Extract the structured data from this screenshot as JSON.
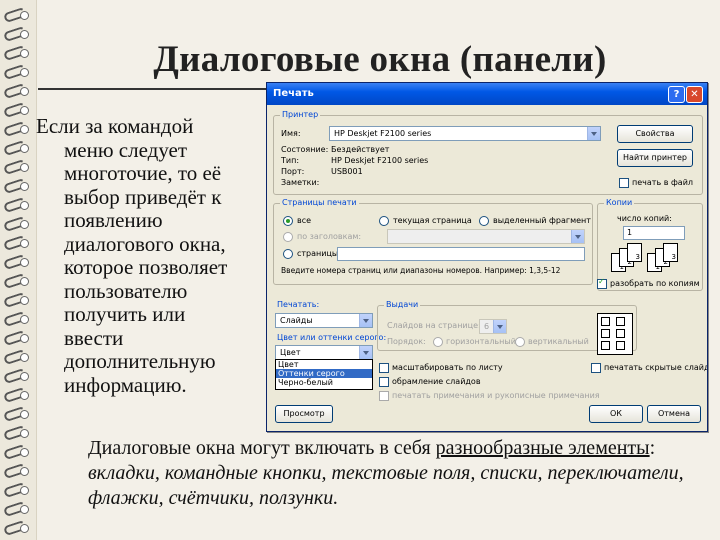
{
  "slide": {
    "title": "Диалоговые окна (панели)",
    "left_lines": [
      "Если за командой",
      "меню следует",
      "многоточие, то её",
      "выбор приведёт к",
      "появлению",
      "диалогового окна,",
      "которое позволяет",
      "пользователю",
      "получить или",
      "ввести",
      "дополнительную",
      "информацию."
    ],
    "bottom_plain": "Диалоговые окна могут включать в себя ",
    "bottom_underlined": "разнообразные элементы",
    "bottom_colon": ": ",
    "bottom_italic": "вкладки, командные кнопки, текстовые поля, списки, переключатели, флажки, счётчики, ползунки."
  },
  "dialog": {
    "title": "Печать",
    "printer_group": "Принтер",
    "name_label": "Имя:",
    "name_value": "HP Deskjet F2100 series",
    "status_label": "Состояние:",
    "status_value": "Бездействует",
    "type_label": "Тип:",
    "type_value": "HP Deskjet F2100 series",
    "port_label": "Порт:",
    "port_value": "USB001",
    "notes_label": "Заметки:",
    "properties_btn": "Свойства",
    "find_printer_btn": "Найти принтер",
    "print_to_file": "печать в файл",
    "pages_group": "Страницы печати",
    "all": "все",
    "current_page": "текущая страница",
    "selection": "выделенный фрагмент",
    "by_headings": "по заголовкам:",
    "pages": "страницы:",
    "pages_hint": "Введите номера страниц или диапазоны номеров. Например: 1,3,5-12",
    "copies_group": "Копии",
    "copies_count": "число копий:",
    "copies_value": "1",
    "collate": "разобрать по копиям",
    "print_label": "Печатать:",
    "print_value": "Слайды",
    "color_label": "Цвет или оттенки серого:",
    "color_value": "Цвет",
    "color_options": [
      "Цвет",
      "Оттенки серого",
      "Черно-белый"
    ],
    "handouts_group": "Выдачи",
    "slides_per_page": "Слайдов на странице:",
    "spp_value": "6",
    "order_label": "Порядок:",
    "horizontal": "горизонтальный",
    "vertical": "вертикальный",
    "fit_to_page": "масштабировать по листу",
    "frame_slides": "обрамление слайдов",
    "print_comments": "печатать примечания и рукописные примечания",
    "print_hidden": "печатать скрытые слайды",
    "preview_btn": "Просмотр",
    "ok_btn": "ОК",
    "cancel_btn": "Отмена",
    "help_glyph": "?",
    "close_glyph": "✕",
    "page_nums": [
      "1",
      "2",
      "3"
    ]
  }
}
